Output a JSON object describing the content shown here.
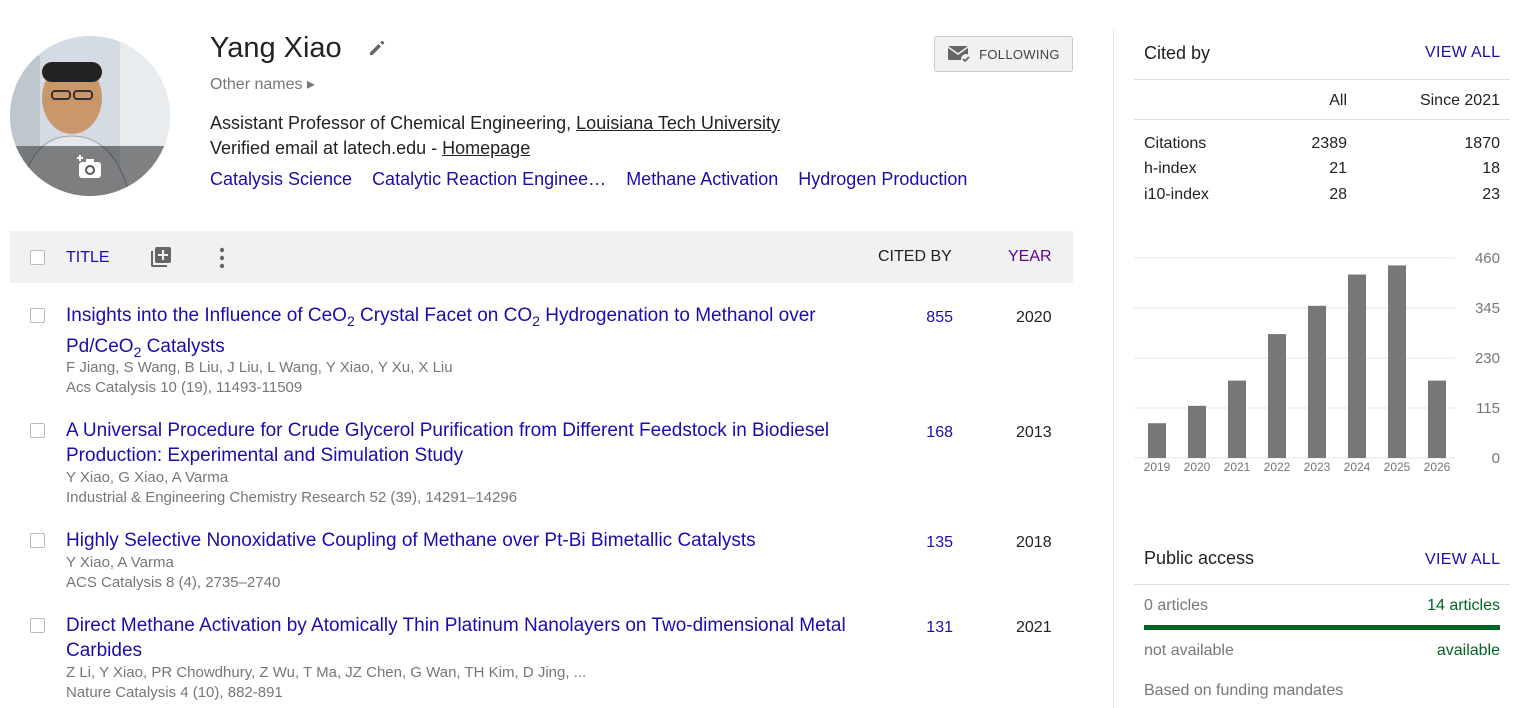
{
  "profile": {
    "name": "Yang Xiao",
    "other_names": "Other names ▸",
    "affiliation_prefix": "Assistant Professor of Chemical Engineering, ",
    "affiliation_link": "Louisiana Tech University",
    "email_prefix": "Verified email at latech.edu - ",
    "homepage": "Homepage",
    "interests": [
      "Catalysis Science",
      "Catalytic Reaction Enginee…",
      "Methane Activation",
      "Hydrogen Production"
    ],
    "follow_label": "FOLLOWING"
  },
  "table": {
    "title_header": "TITLE",
    "cited_header": "CITED BY",
    "year_header": "YEAR",
    "rows": [
      {
        "title_parts": [
          "Insights into the Influence of CeO",
          "2",
          " Crystal Facet on CO",
          "2",
          " Hydrogenation to Methanol over Pd/CeO",
          "2",
          " Catalysts"
        ],
        "authors": "F Jiang, S Wang, B Liu, J Liu, L Wang, Y Xiao, Y Xu, X Liu",
        "venue": "Acs Catalysis 10 (19), 11493-11509",
        "cited": "855",
        "year": "2020"
      },
      {
        "title": "A Universal Procedure for Crude Glycerol Purification from Different Feedstock in Biodiesel Production: Experimental and Simulation Study",
        "authors": "Y Xiao, G Xiao, A Varma",
        "venue": "Industrial & Engineering Chemistry Research 52 (39), 14291–14296",
        "cited": "168",
        "year": "2013"
      },
      {
        "title": "Highly Selective Nonoxidative Coupling of Methane over Pt-Bi Bimetallic Catalysts",
        "authors": "Y Xiao, A Varma",
        "venue": "ACS Catalysis 8 (4), 2735–2740",
        "cited": "135",
        "year": "2018"
      },
      {
        "title": "Direct Methane Activation by Atomically Thin Platinum Nanolayers on Two-dimensional Metal Carbides",
        "authors": "Z Li, Y Xiao, PR Chowdhury, Z Wu, T Ma, JZ Chen, G Wan, TH Kim, D Jing, ...",
        "venue": "Nature Catalysis 4 (10), 882-891",
        "cited": "131",
        "year": "2021"
      }
    ]
  },
  "cited_by": {
    "heading": "Cited by",
    "view_all": "VIEW ALL",
    "col_all": "All",
    "col_since": "Since 2021",
    "stats": [
      {
        "label": "Citations",
        "all": "2389",
        "since": "1870"
      },
      {
        "label": "h-index",
        "all": "21",
        "since": "18"
      },
      {
        "label": "i10-index",
        "all": "28",
        "since": "23"
      }
    ]
  },
  "chart_data": {
    "type": "bar",
    "categories": [
      "2019",
      "2020",
      "2021",
      "2022",
      "2023",
      "2024",
      "2025",
      "2026"
    ],
    "values": [
      80,
      120,
      178,
      285,
      350,
      422,
      443,
      178
    ],
    "y_ticks": [
      "460",
      "345",
      "230",
      "115",
      "0"
    ],
    "ylim": [
      0,
      460
    ],
    "bar_color": "#777777",
    "grid": true
  },
  "public_access": {
    "heading": "Public access",
    "view_all": "VIEW ALL",
    "not_avail_count": "0 articles",
    "avail_count": "14 articles",
    "not_avail_label": "not available",
    "avail_label": "available",
    "footer": "Based on funding mandates",
    "available_fraction": 1.0,
    "available_color": "#006621"
  }
}
